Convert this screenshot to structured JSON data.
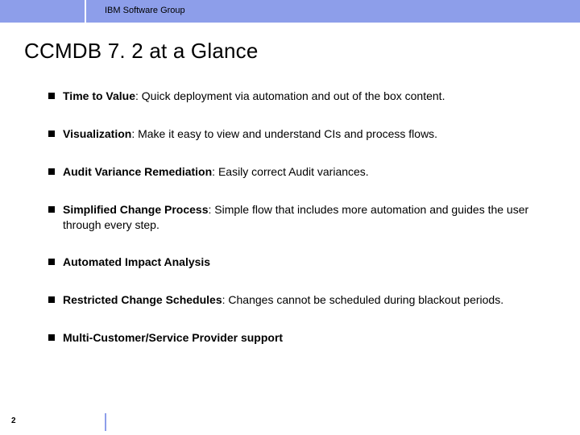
{
  "header": {
    "group": "IBM Software Group"
  },
  "title": "CCMDB 7. 2 at a Glance",
  "bullets": [
    {
      "label": "Time to Value",
      "rest": ": Quick deployment via automation and out of the box content."
    },
    {
      "label": "Visualization",
      "rest": ": Make it easy to view and understand CIs and process flows."
    },
    {
      "label": "Audit Variance Remediation",
      "rest": ": Easily correct Audit variances."
    },
    {
      "label": "Simplified Change Process",
      "rest": ": Simple flow that includes more automation and guides the user through every step."
    },
    {
      "label": "Automated Impact Analysis",
      "rest": ""
    },
    {
      "label": "Restricted Change Schedules",
      "rest": ": Changes cannot be scheduled during blackout periods."
    },
    {
      "label": "Multi-Customer/Service Provider support",
      "rest": ""
    }
  ],
  "footer": {
    "page": "2"
  }
}
